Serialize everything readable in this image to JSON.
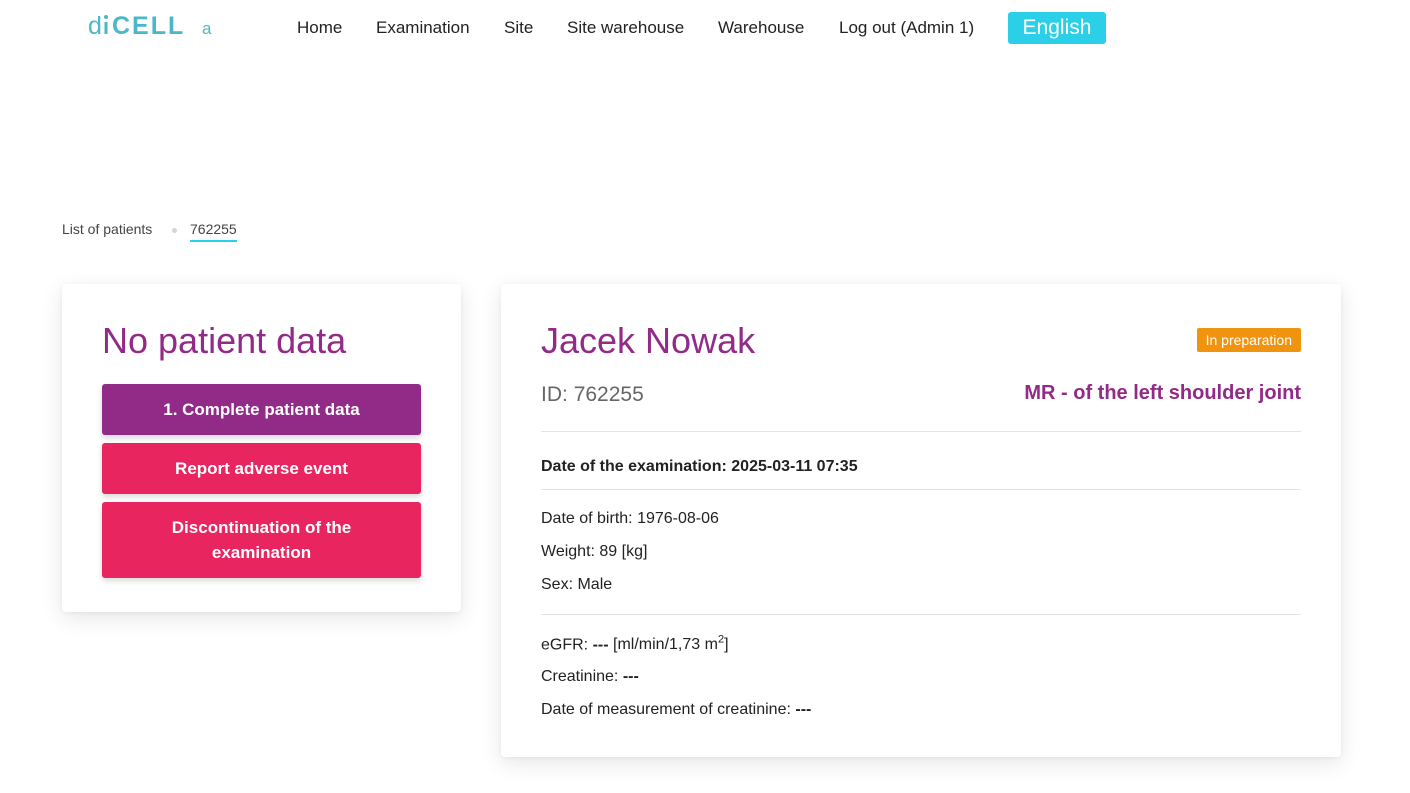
{
  "header": {
    "logo_text": "diCELLa",
    "nav": [
      {
        "id": "home",
        "label": "Home"
      },
      {
        "id": "examination",
        "label": "Examination"
      },
      {
        "id": "site",
        "label": "Site"
      },
      {
        "id": "site-warehouse",
        "label": "Site warehouse"
      },
      {
        "id": "warehouse",
        "label": "Warehouse"
      },
      {
        "id": "logout",
        "label": "Log out (Admin 1)"
      }
    ],
    "language": "English"
  },
  "breadcrumb": {
    "root": "List of patients",
    "current": "762255"
  },
  "left_panel": {
    "title": "No patient data",
    "buttons": {
      "complete": "1. Complete patient data",
      "adverse": "Report adverse event",
      "discontinue": "Discontinuation of the examination"
    }
  },
  "patient": {
    "name": "Jacek Nowak",
    "status": "In preparation",
    "id_label": "ID:",
    "id": "762255",
    "exam_type": "MR - of the left shoulder joint",
    "exam_date_label": "Date of the examination:",
    "exam_date": "2025-03-11 07:35",
    "dob_label": "Date of birth:",
    "dob": "1976-08-06",
    "weight_label": "Weight:",
    "weight": "89 [kg]",
    "sex_label": "Sex:",
    "sex": "Male",
    "egfr_label": "eGFR:",
    "egfr": "---",
    "egfr_unit": "[ml/min/1,73 m",
    "egfr_unit_sup": "2",
    "egfr_unit_end": "]",
    "creatinine_label": "Creatinine:",
    "creatinine": "---",
    "creatinine_date_label": "Date of measurement of creatinine:",
    "creatinine_date": "---"
  },
  "colors": {
    "brand_purple": "#922b87",
    "brand_pink": "#e8255e",
    "accent_cyan": "#2bcfe8",
    "status_orange": "#f0930f"
  }
}
